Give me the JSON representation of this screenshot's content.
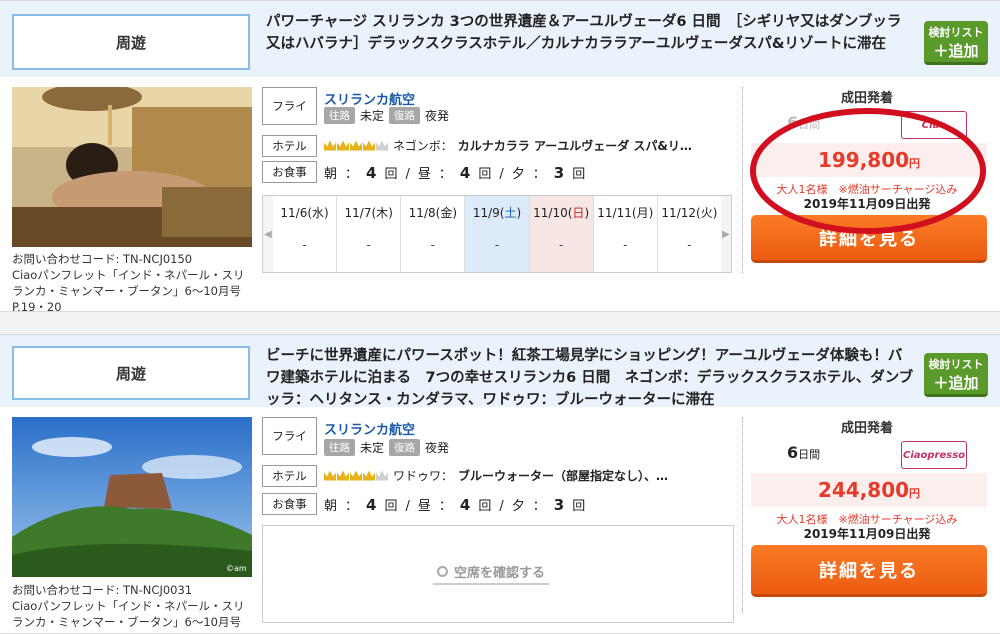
{
  "tours": [
    {
      "category": "周遊",
      "title": "パワーチャージ スリランカ 3つの世界遺産＆アーユルヴェーダ6 日間　［シギリヤ又はダンブッラ又はハバラナ］デラックスクラスホテル／カルナカララアーユルヴェーダスパ&リゾートに滞在",
      "add_label_top": "検討リスト",
      "add_label_bottom": "＋追加",
      "code": "お問い合わせコード: TN-NCJ0150",
      "pamphlet": "Ciaoパンフレット「インド・ネパール・スリランカ・ミャンマー・ブータン」6〜10月号 P.19・20",
      "flight_label": "フライト",
      "airline": "スリランカ航空",
      "outbound_tag": "往路",
      "outbound": "未定",
      "return_tag": "復路",
      "return": "夜発",
      "hotel_label": "ホテル",
      "hotel": "ネゴンボ：",
      "hotel_name": "カルナカララ アーユルヴェーダ スパ&リ…",
      "meal_label": "お食事",
      "meals": {
        "breakfast_label": "朝",
        "breakfast": "4",
        "lunch_label": "昼",
        "lunch": "4",
        "dinner_label": "夕",
        "dinner": "3",
        "unit": "回",
        "sep": "/",
        "colon": "："
      },
      "calendar": [
        {
          "date": "11/6",
          "dow": "水",
          "val": "-",
          "kind": "weekday"
        },
        {
          "date": "11/7",
          "dow": "木",
          "val": "-",
          "kind": "weekday"
        },
        {
          "date": "11/8",
          "dow": "金",
          "val": "-",
          "kind": "weekday"
        },
        {
          "date": "11/9",
          "dow": "土",
          "val": "-",
          "kind": "sat"
        },
        {
          "date": "11/10",
          "dow": "日",
          "val": "-",
          "kind": "sun"
        },
        {
          "date": "11/11",
          "dow": "月",
          "val": "-",
          "kind": "weekday"
        },
        {
          "date": "11/12",
          "dow": "火",
          "val": "-",
          "kind": "weekday"
        }
      ],
      "departure": "成田発着",
      "days_num": "6",
      "days_unit": "日間",
      "logo": "Ciao",
      "price": "199,800",
      "price_unit": "円",
      "price_note": "大人1名様　※燃油サーチャージ込み",
      "price_date": "2019年11月09日出発",
      "detail_label": "詳細を見る"
    },
    {
      "category": "周遊",
      "title": "ビーチに世界遺産にパワースポット！紅茶工場見学にショッピング！アーユルヴェーダ体験も！バワ建築ホテルに泊まる　7つの幸せスリランカ6 日間　ネゴンボ：デラックスクラスホテル、ダンブッラ：ヘリタンス・カンダラマ、ワドゥワ：ブルーウォーターに滞在",
      "add_label_top": "検討リスト",
      "add_label_bottom": "＋追加",
      "code": "お問い合わせコード: TN-NCJ0031",
      "pamphlet": "Ciaoパンフレット「インド・ネパール・スリランカ・ミャンマー・ブータン」6〜10月号",
      "flight_label": "フライト",
      "airline": "スリランカ航空",
      "outbound_tag": "往路",
      "outbound": "未定",
      "return_tag": "復路",
      "return": "夜発",
      "hotel_label": "ホテル",
      "hotel": "ワドゥワ：",
      "hotel_name": "ブルーウォーター（部屋指定なし）、…",
      "meal_label": "お食事",
      "meals": {
        "breakfast_label": "朝",
        "breakfast": "4",
        "lunch_label": "昼",
        "lunch": "4",
        "dinner_label": "夕",
        "dinner": "3",
        "unit": "回",
        "sep": "/",
        "colon": "："
      },
      "vacancy_label": "空席を確認する",
      "departure": "成田発着",
      "days_num": "6",
      "days_unit": "日間",
      "logo": "Ciaopresso",
      "price": "244,800",
      "price_unit": "円",
      "price_note": "大人1名様　※燃油サーチャージ込み",
      "price_date": "2019年11月09日出発",
      "detail_label": "詳細を見る",
      "photo_credit": "©am"
    }
  ],
  "colors": {
    "accent_blue": "#1a5aa8",
    "price_red": "#e43b2b",
    "button_orange": "#ec5c12",
    "add_green": "#5a9a2a",
    "highlight_ring": "#d10f1f"
  },
  "icons": [
    "crown-icon",
    "search-icon",
    "chevron-left-icon",
    "chevron-right-icon"
  ]
}
